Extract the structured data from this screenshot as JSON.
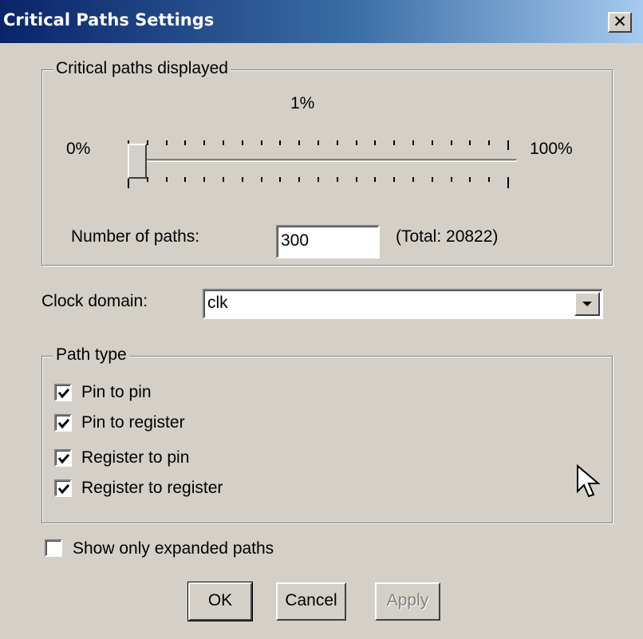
{
  "window": {
    "title": "Critical Paths Settings",
    "close_symbol": "✕"
  },
  "critical_paths": {
    "group_label": "Critical paths displayed",
    "slider_value_label": "1%",
    "min_label": "0%",
    "max_label": "100%",
    "slider_percent": 1,
    "number_of_paths_label": "Number of paths:",
    "number_of_paths_value": "300",
    "total_label": "(Total: 20822)"
  },
  "clock_domain": {
    "label": "Clock domain:",
    "value": "clk"
  },
  "path_type": {
    "group_label": "Path type",
    "options": [
      {
        "label": "Pin to pin",
        "checked": true
      },
      {
        "label": "Pin to register",
        "checked": true
      },
      {
        "label": "Register to pin",
        "checked": true
      },
      {
        "label": "Register to register",
        "checked": true
      }
    ]
  },
  "show_expanded": {
    "label": "Show only expanded paths",
    "checked": false
  },
  "buttons": {
    "ok": "OK",
    "cancel": "Cancel",
    "apply": "Apply"
  },
  "icons": {
    "close": "close-icon",
    "dropdown": "chevron-down-icon",
    "check": "check-icon",
    "cursor": "mouse-pointer-icon"
  }
}
